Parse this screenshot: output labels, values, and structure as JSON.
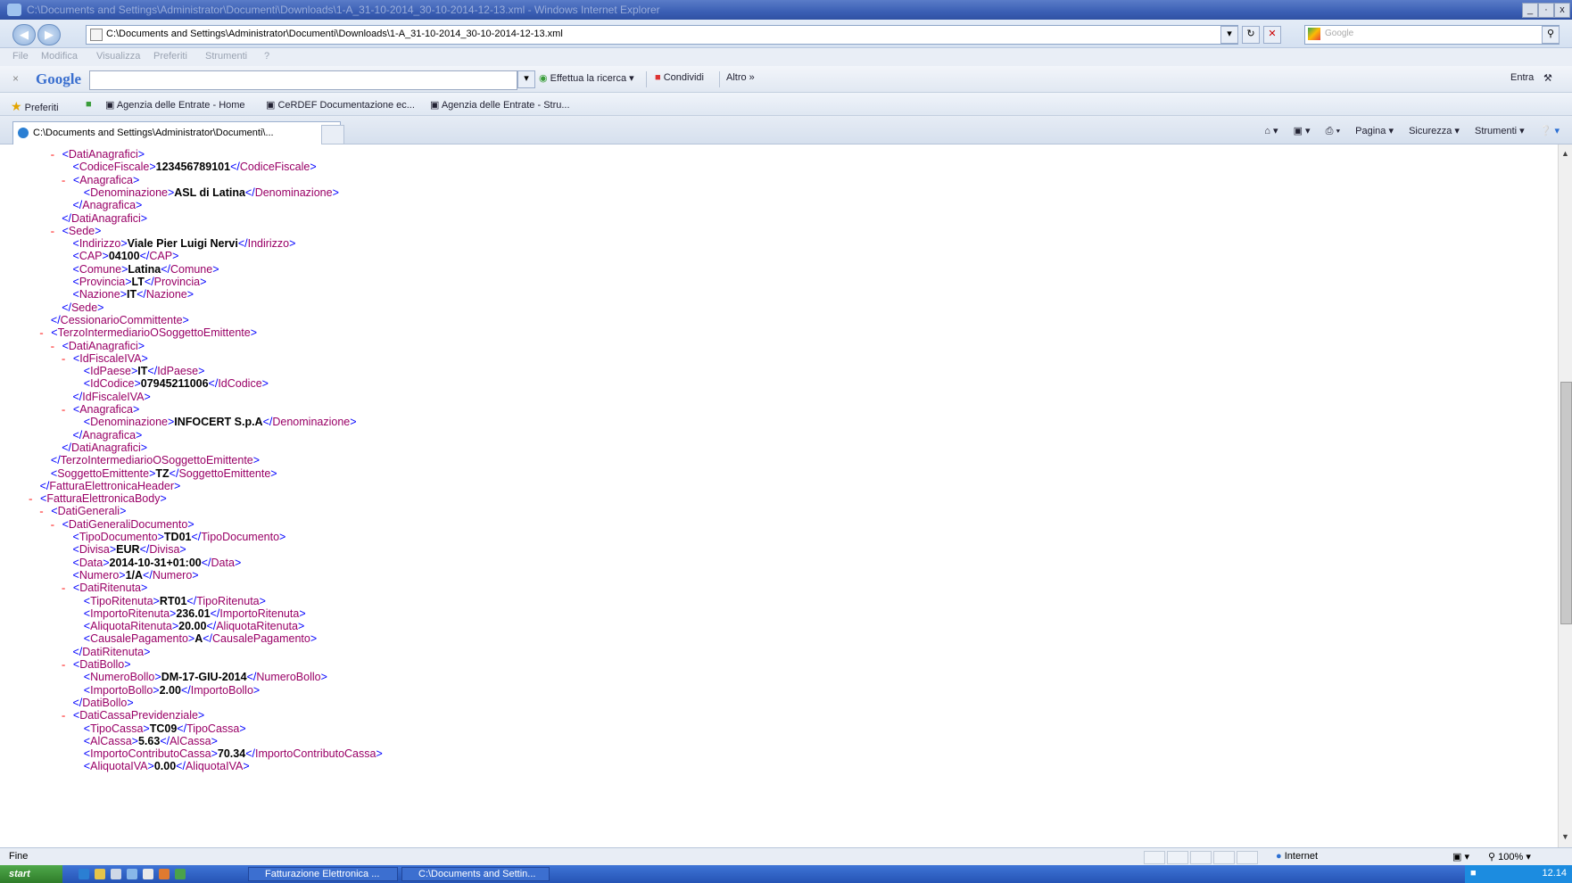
{
  "window": {
    "title": "C:\\Documents and Settings\\Administrator\\Documenti\\Downloads\\1-A_31-10-2014_30-10-2014-12-13.xml - Windows Internet Explorer",
    "controls": [
      "_",
      "·",
      "x"
    ]
  },
  "address": {
    "url": "C:\\Documents and Settings\\Administrator\\Documenti\\Downloads\\1-A_31-10-2014_30-10-2014-12-13.xml",
    "search_placeholder": "Google"
  },
  "menu": [
    "File",
    "Modifica",
    "Visualizza",
    "Preferiti",
    "Strumenti",
    "?"
  ],
  "google_toolbar": {
    "logo": "Google",
    "search_label": "Effettua la ricerca",
    "share_label": "Condividi",
    "more_label": "Altro »",
    "signin_label": "Entra"
  },
  "favorites": {
    "label": "Preferiti",
    "items": [
      "Agenzia delle Entrate - Home",
      "CeRDEF Documentazione ec...",
      "Agenzia delle Entrate - Stru..."
    ]
  },
  "tab": {
    "label": "C:\\Documents and Settings\\Administrator\\Documenti\\..."
  },
  "command_bar": [
    "Pagina ▾",
    "Sicurezza ▾",
    "Strumenti ▾"
  ],
  "status": {
    "left": "Fine",
    "zone": "Internet",
    "zoom": "100%"
  },
  "taskbar": {
    "start": "start",
    "buttons": [
      "Fatturazione Elettronica ...",
      "C:\\Documents and Settin..."
    ],
    "clock": "12.14"
  },
  "xml_lines": [
    {
      "minus": true,
      "open": "DatiAnagrafici",
      "value": "",
      "close": ""
    },
    {
      "minus": false,
      "open": "CodiceFiscale",
      "value": "123456789101",
      "close": "CodiceFiscale"
    },
    {
      "minus": true,
      "open": "Anagrafica",
      "value": "",
      "close": ""
    },
    {
      "minus": false,
      "open": "Denominazione",
      "value": "ASL di Latina",
      "close": "Denominazione"
    },
    {
      "minus": false,
      "open": "",
      "value": "",
      "close": "Anagrafica"
    },
    {
      "minus": false,
      "open": "",
      "value": "",
      "close": "DatiAnagrafici"
    },
    {
      "minus": true,
      "open": "Sede",
      "value": "",
      "close": ""
    },
    {
      "minus": false,
      "open": "Indirizzo",
      "value": "Viale Pier Luigi Nervi",
      "close": "Indirizzo"
    },
    {
      "minus": false,
      "open": "CAP",
      "value": "04100",
      "close": "CAP"
    },
    {
      "minus": false,
      "open": "Comune",
      "value": "Latina",
      "close": "Comune"
    },
    {
      "minus": false,
      "open": "Provincia",
      "value": "LT",
      "close": "Provincia"
    },
    {
      "minus": false,
      "open": "Nazione",
      "value": "IT",
      "close": "Nazione"
    },
    {
      "minus": false,
      "open": "",
      "value": "",
      "close": "Sede"
    },
    {
      "minus": false,
      "open": "",
      "value": "",
      "close": "CessionarioCommittente"
    },
    {
      "minus": true,
      "open": "TerzoIntermediarioOSoggettoEmittente",
      "value": "",
      "close": ""
    },
    {
      "minus": true,
      "open": "DatiAnagrafici",
      "value": "",
      "close": ""
    },
    {
      "minus": true,
      "open": "IdFiscaleIVA",
      "value": "",
      "close": ""
    },
    {
      "minus": false,
      "open": "IdPaese",
      "value": "IT",
      "close": "IdPaese"
    },
    {
      "minus": false,
      "open": "IdCodice",
      "value": "07945211006",
      "close": "IdCodice"
    },
    {
      "minus": false,
      "open": "",
      "value": "",
      "close": "IdFiscaleIVA"
    },
    {
      "minus": true,
      "open": "Anagrafica",
      "value": "",
      "close": ""
    },
    {
      "minus": false,
      "open": "Denominazione",
      "value": "INFOCERT S.p.A",
      "close": "Denominazione"
    },
    {
      "minus": false,
      "open": "",
      "value": "",
      "close": "Anagrafica"
    },
    {
      "minus": false,
      "open": "",
      "value": "",
      "close": "DatiAnagrafici"
    },
    {
      "minus": false,
      "open": "",
      "value": "",
      "close": "TerzoIntermediarioOSoggettoEmittente"
    },
    {
      "minus": false,
      "open": "SoggettoEmittente",
      "value": "TZ",
      "close": "SoggettoEmittente"
    },
    {
      "minus": false,
      "open": "",
      "value": "",
      "close": "FatturaElettronicaHeader"
    },
    {
      "minus": true,
      "open": "FatturaElettronicaBody",
      "value": "",
      "close": ""
    },
    {
      "minus": true,
      "open": "DatiGenerali",
      "value": "",
      "close": ""
    },
    {
      "minus": true,
      "open": "DatiGeneraliDocumento",
      "value": "",
      "close": ""
    },
    {
      "minus": false,
      "open": "TipoDocumento",
      "value": "TD01",
      "close": "TipoDocumento"
    },
    {
      "minus": false,
      "open": "Divisa",
      "value": "EUR",
      "close": "Divisa"
    },
    {
      "minus": false,
      "open": "Data",
      "value": "2014-10-31+01:00",
      "close": "Data"
    },
    {
      "minus": false,
      "open": "Numero",
      "value": "1/A",
      "close": "Numero"
    },
    {
      "minus": true,
      "open": "DatiRitenuta",
      "value": "",
      "close": ""
    },
    {
      "minus": false,
      "open": "TipoRitenuta",
      "value": "RT01",
      "close": "TipoRitenuta"
    },
    {
      "minus": false,
      "open": "ImportoRitenuta",
      "value": "236.01",
      "close": "ImportoRitenuta"
    },
    {
      "minus": false,
      "open": "AliquotaRitenuta",
      "value": "20.00",
      "close": "AliquotaRitenuta"
    },
    {
      "minus": false,
      "open": "CausalePagamento",
      "value": "A",
      "close": "CausalePagamento"
    },
    {
      "minus": false,
      "open": "",
      "value": "",
      "close": "DatiRitenuta"
    },
    {
      "minus": true,
      "open": "DatiBollo",
      "value": "",
      "close": ""
    },
    {
      "minus": false,
      "open": "NumeroBollo",
      "value": "DM-17-GIU-2014",
      "close": "NumeroBollo"
    },
    {
      "minus": false,
      "open": "ImportoBollo",
      "value": "2.00",
      "close": "ImportoBollo"
    },
    {
      "minus": false,
      "open": "",
      "value": "",
      "close": "DatiBollo"
    },
    {
      "minus": true,
      "open": "DatiCassaPrevidenziale",
      "value": "",
      "close": ""
    },
    {
      "minus": false,
      "open": "TipoCassa",
      "value": "TC09",
      "close": "TipoCassa"
    },
    {
      "minus": false,
      "open": "AlCassa",
      "value": "5.63",
      "close": "AlCassa"
    },
    {
      "minus": false,
      "open": "ImportoContributoCassa",
      "value": "70.34",
      "close": "ImportoContributoCassa"
    },
    {
      "minus": false,
      "open": "AliquotaIVA",
      "value": "0.00",
      "close": "AliquotaIVA"
    }
  ]
}
